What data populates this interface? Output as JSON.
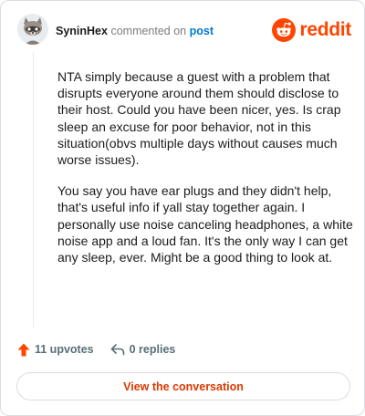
{
  "header": {
    "username": "SyninHex",
    "action_text": "commented on",
    "post_link": "post",
    "brand": "reddit",
    "avatar_icon": "avatar-raccoon-icon",
    "brand_icon": "reddit-alien-icon",
    "brand_color": "#ff4500"
  },
  "comment": {
    "paragraphs": [
      "NTA simply because a guest with a problem that disrupts everyone around them should disclose to their host. Could you have been nicer, yes. Is crap sleep an excuse for poor behavior, not in this situation(obvs multiple days without causes much worse issues).",
      "You say you have ear plugs and they didn't help, that's useful info if yall stay together again. I personally use noise canceling headphones, a white noise app and a loud fan. It's the only way I can get any sleep, ever. Might be a good thing to look at."
    ]
  },
  "actions": {
    "upvotes": "11 upvotes",
    "replies": "0 replies",
    "upvote_icon": "upvote-arrow-icon",
    "reply_icon": "reply-arrow-icon",
    "upvote_color": "#ff4500"
  },
  "cta": {
    "label": "View the conversation",
    "color": "#d93a00"
  }
}
